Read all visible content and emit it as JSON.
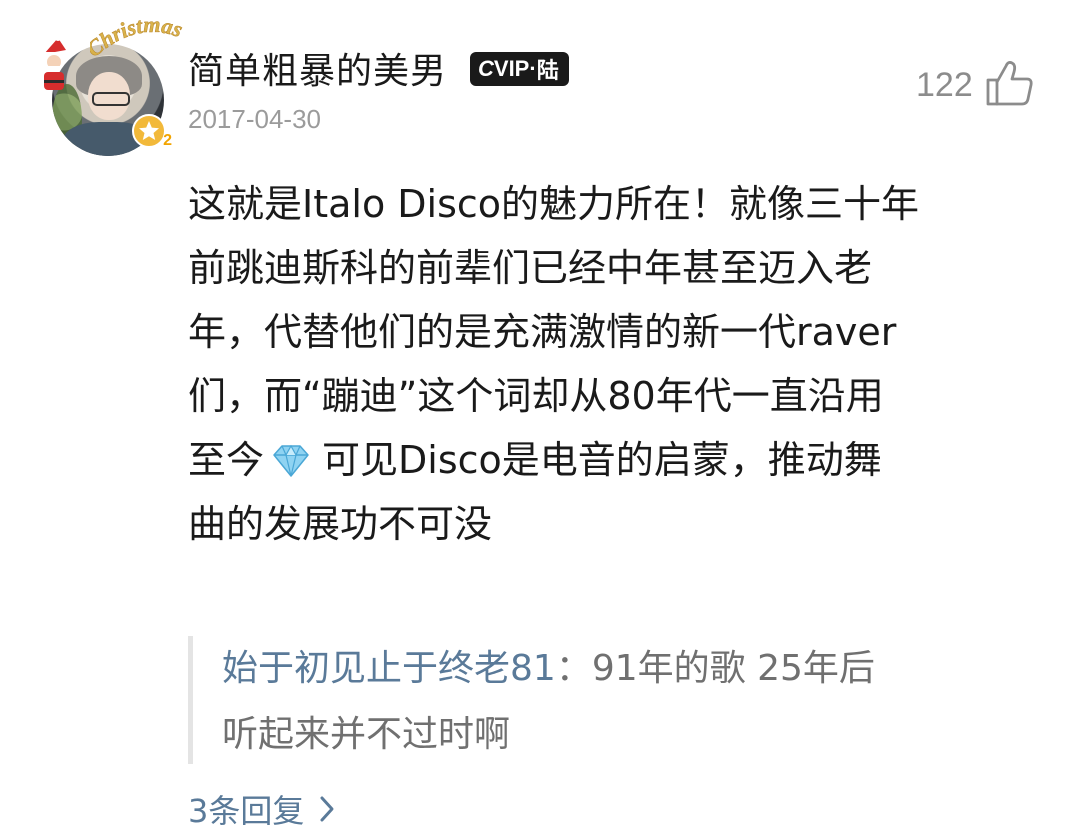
{
  "comment": {
    "username": "简单粗暴的美男",
    "badge": {
      "c": "C",
      "vip": "VIP",
      "sep": "·",
      "level": "陆"
    },
    "date": "2017-04-30",
    "likes": "122",
    "avatar_decoration_text": "Christmas",
    "user_level": "2",
    "body": {
      "line1": "这就是Italo Disco的魅力所在！就像三十年",
      "line2": "前跳迪斯科的前辈们已经中年甚至迈入老",
      "line3": "年，代替他们的是充满激情的新一代raver",
      "line4": "们，而“蹦迪”这个词却从80年代一直沿用",
      "line5_before_icon": "至今",
      "line5_after_icon": "可见Disco是电音的启蒙，推动舞",
      "line6": "曲的发展功不可没"
    },
    "reply_preview": {
      "author": "始于初见止于终老81",
      "separator": "：",
      "text_line1": "91年的歌 25年后",
      "text_line2": "听起来并不过时啊"
    },
    "replies_link": "3条回复"
  },
  "colors": {
    "username": "#1a1a1a",
    "date": "#9b9b9b",
    "link": "#5a7a99",
    "badge_bg": "#1a1a1a",
    "level_badge": "#f2b93a"
  },
  "icons": {
    "like": "thumbs-up-icon",
    "diamond": "diamond-emoji-icon",
    "chevron": "chevron-right-icon",
    "santa": "santa-icon",
    "level": "star-level-icon"
  }
}
